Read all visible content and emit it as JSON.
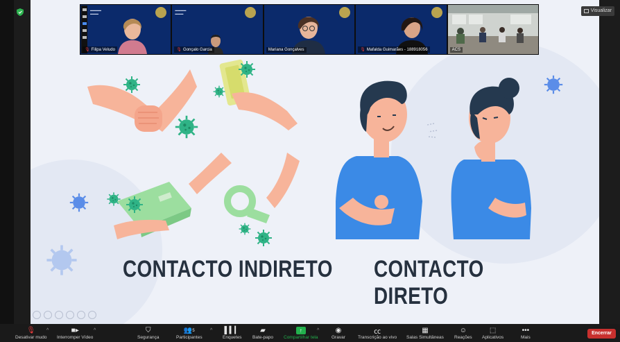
{
  "top": {
    "view_label": "Visualizar"
  },
  "gallery": [
    {
      "name": "Filipa Veludo",
      "muted": true
    },
    {
      "name": "Gonçalo Garcia",
      "muted": true
    },
    {
      "name": "Mariana Gonçalves",
      "muted": false
    },
    {
      "name": "Mafalda Guimarães - 188918056",
      "muted": true
    },
    {
      "name": "ACS",
      "muted": false
    }
  ],
  "slide": {
    "left_caption": "CONTACTO INDIRETO",
    "right_caption": "CONTACTO DIRETO"
  },
  "toolbar": {
    "mute": "Desativar mudo",
    "video": "Interromper Vídeo",
    "security": "Segurança",
    "participants": "Participantes",
    "participants_count": "5",
    "polls": "Enquetes",
    "chat": "Bate-papo",
    "share": "Compartilhar tela",
    "record": "Gravar",
    "transcription": "Transcrição ao vivo",
    "breakout": "Salas Simultâneas",
    "reactions": "Reações",
    "apps": "Aplicativos",
    "more": "Mais",
    "end": "Encerrar"
  },
  "colors": {
    "virus": "#2fb386",
    "virus_blue": "#5b8de8",
    "shirt": "#3b8ae6",
    "skin": "#f7b49a",
    "end": "#c8302e"
  }
}
